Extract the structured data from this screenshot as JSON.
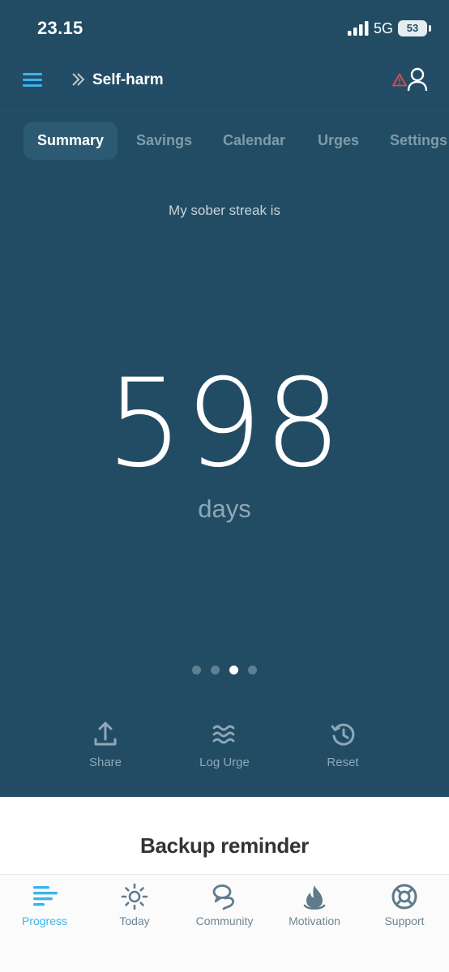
{
  "status_bar": {
    "time": "23.15",
    "network": "5G",
    "battery": "53"
  },
  "header": {
    "title": "Self-harm"
  },
  "tabs": [
    {
      "label": "Summary",
      "active": true
    },
    {
      "label": "Savings",
      "active": false
    },
    {
      "label": "Calendar",
      "active": false
    },
    {
      "label": "Urges",
      "active": false
    },
    {
      "label": "Settings",
      "active": false
    }
  ],
  "streak": {
    "label": "My sober streak is",
    "value": "598",
    "unit": "days"
  },
  "pager": {
    "count": 4,
    "active_index": 2
  },
  "actions": [
    {
      "label": "Share",
      "icon": "share-icon"
    },
    {
      "label": "Log Urge",
      "icon": "waves-icon"
    },
    {
      "label": "Reset",
      "icon": "history-icon"
    }
  ],
  "backup": {
    "title": "Backup reminder"
  },
  "bottom_nav": [
    {
      "label": "Progress",
      "icon": "progress-icon",
      "active": true
    },
    {
      "label": "Today",
      "icon": "sun-icon",
      "active": false
    },
    {
      "label": "Community",
      "icon": "community-icon",
      "active": false
    },
    {
      "label": "Motivation",
      "icon": "flame-icon",
      "active": false
    },
    {
      "label": "Support",
      "icon": "lifebuoy-icon",
      "active": false
    }
  ],
  "colors": {
    "background": "#224c64",
    "accent": "#3bb4ee",
    "muted": "#8ea8b7",
    "warning": "#e5484d"
  }
}
